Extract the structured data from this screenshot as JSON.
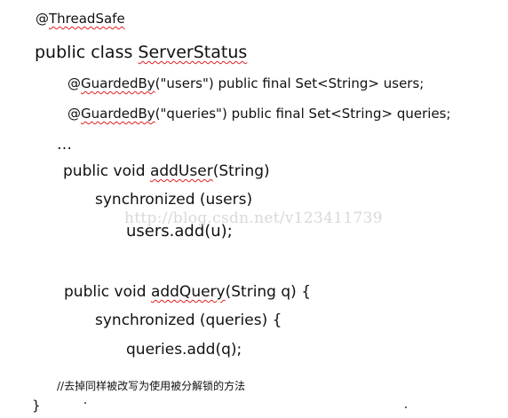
{
  "code": {
    "annotation": {
      "at": "@",
      "name": "ThreadSafe"
    },
    "class_decl": {
      "prefix": "public class ",
      "name": "ServerStatus"
    },
    "field_users": {
      "at": "@",
      "ann": "GuardedBy",
      "args": "(\"users\") public final Set<String> users;"
    },
    "field_queries": {
      "at": "@",
      "ann": "GuardedBy",
      "args": "(\"queries\") public final Set<String> queries;"
    },
    "ellipsis": "…",
    "method_add_user": {
      "prefix": "public void ",
      "name": "addUser",
      "args": "(String)"
    },
    "sync_users": "synchronized (users)",
    "users_add": "users.add(u);",
    "method_add_query": {
      "prefix": "public void ",
      "name": "addQuery",
      "args": "(String q) {"
    },
    "sync_queries": "synchronized (queries) {",
    "queries_add": "queries.add(q);",
    "comment": "//去掉同样被改写为使用被分解锁的方法",
    "closing_brace": "}"
  },
  "watermark": "http://blog.csdn.net/v123411739"
}
